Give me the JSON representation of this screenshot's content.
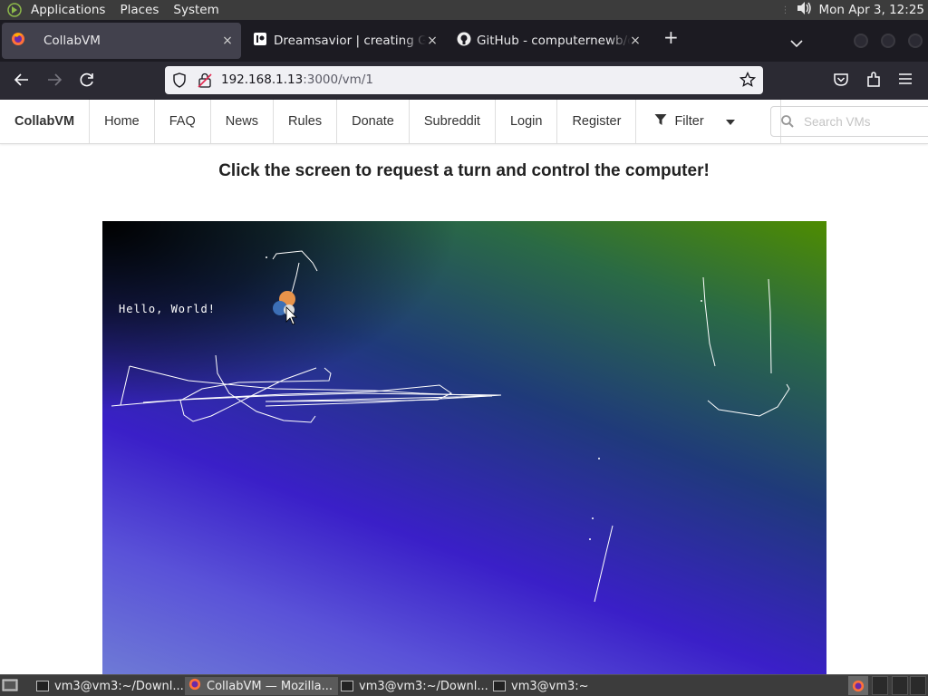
{
  "top_panel": {
    "menus": [
      "Applications",
      "Places",
      "System"
    ],
    "clock": "Mon Apr  3, 12:25"
  },
  "browser": {
    "tabs": [
      {
        "title": "CollabVM",
        "active": true
      },
      {
        "title": "Dreamsavior | creating Gam",
        "active": false
      },
      {
        "title": "GitHub - computernewb/coll",
        "active": false
      }
    ],
    "close_glyph": "×",
    "new_tab_glyph": "+",
    "url_host": "192.168.1.13",
    "url_path": ":3000/vm/1"
  },
  "site_nav": {
    "brand": "CollabVM",
    "items": [
      "Home",
      "FAQ",
      "News",
      "Rules",
      "Donate",
      "Subreddit",
      "Login",
      "Register"
    ],
    "filter_label": "Filter",
    "search_placeholder": "Search VMs"
  },
  "headline": "Click the screen to request a turn and control the computer!",
  "vm": {
    "hello_text": "Hello, World!"
  },
  "taskbar": {
    "tasks": [
      {
        "label": "vm3@vm3:~/Downl...",
        "icon": "terminal-icon"
      },
      {
        "label": "CollabVM — Mozilla...",
        "icon": "firefox-icon"
      },
      {
        "label": "vm3@vm3:~/Downl...",
        "icon": "terminal-icon"
      },
      {
        "label": "vm3@vm3:~",
        "icon": "terminal-icon"
      }
    ]
  }
}
